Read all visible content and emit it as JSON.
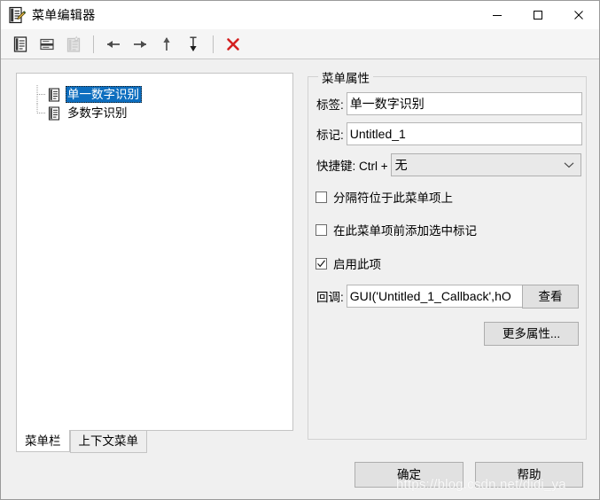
{
  "window": {
    "title": "菜单编辑器",
    "icon": "menu-editor-icon",
    "minimize_label": "最小化",
    "maximize_label": "最大化",
    "close_label": "关闭"
  },
  "toolbar": {
    "items": [
      {
        "name": "new-menu-icon",
        "label": "新建菜单",
        "enabled": true
      },
      {
        "name": "new-menu-item-icon",
        "label": "新建菜单项",
        "enabled": true
      },
      {
        "name": "new-context-menu-icon",
        "label": "新建上下文菜单",
        "enabled": false
      },
      {
        "name": "move-left-icon",
        "label": "左移",
        "enabled": true
      },
      {
        "name": "move-right-icon",
        "label": "右移",
        "enabled": true
      },
      {
        "name": "move-up-icon",
        "label": "上移",
        "enabled": true
      },
      {
        "name": "move-down-icon",
        "label": "下移",
        "enabled": true
      },
      {
        "name": "delete-icon",
        "label": "删除",
        "enabled": true
      }
    ]
  },
  "tree": {
    "items": [
      {
        "label": "单一数字识别",
        "selected": true
      },
      {
        "label": "多数字识别",
        "selected": false
      }
    ]
  },
  "tabs": [
    {
      "label": "菜单栏",
      "active": true
    },
    {
      "label": "上下文菜单",
      "active": false
    }
  ],
  "properties": {
    "group_title": "菜单属性",
    "label_field": {
      "label": "标签:",
      "value": "单一数字识别",
      "placeholder": ""
    },
    "tag_field": {
      "label": "标记:",
      "value": "Untitled_1",
      "placeholder": ""
    },
    "accelerator": {
      "label": "快捷键: Ctrl +",
      "value": "无",
      "options": [
        "无"
      ]
    },
    "checkboxes": [
      {
        "label": "分隔符位于此菜单项上",
        "checked": false
      },
      {
        "label": "在此菜单项前添加选中标记",
        "checked": false
      },
      {
        "label": "启用此项",
        "checked": true
      }
    ],
    "callback": {
      "label": "回调:",
      "value": "GUI('Untitled_1_Callback',hO",
      "placeholder": "",
      "view_button": "查看"
    },
    "more_button": "更多属性..."
  },
  "footer": {
    "ok_button": "确定",
    "help_button": "帮助"
  },
  "watermark": "https://blog.csdn.net/didi_ya",
  "colors": {
    "selection": "#0d6ebf",
    "window_bg": "#f0f0f0",
    "panel_bg": "#ffffff",
    "delete_icon": "#d42020"
  }
}
